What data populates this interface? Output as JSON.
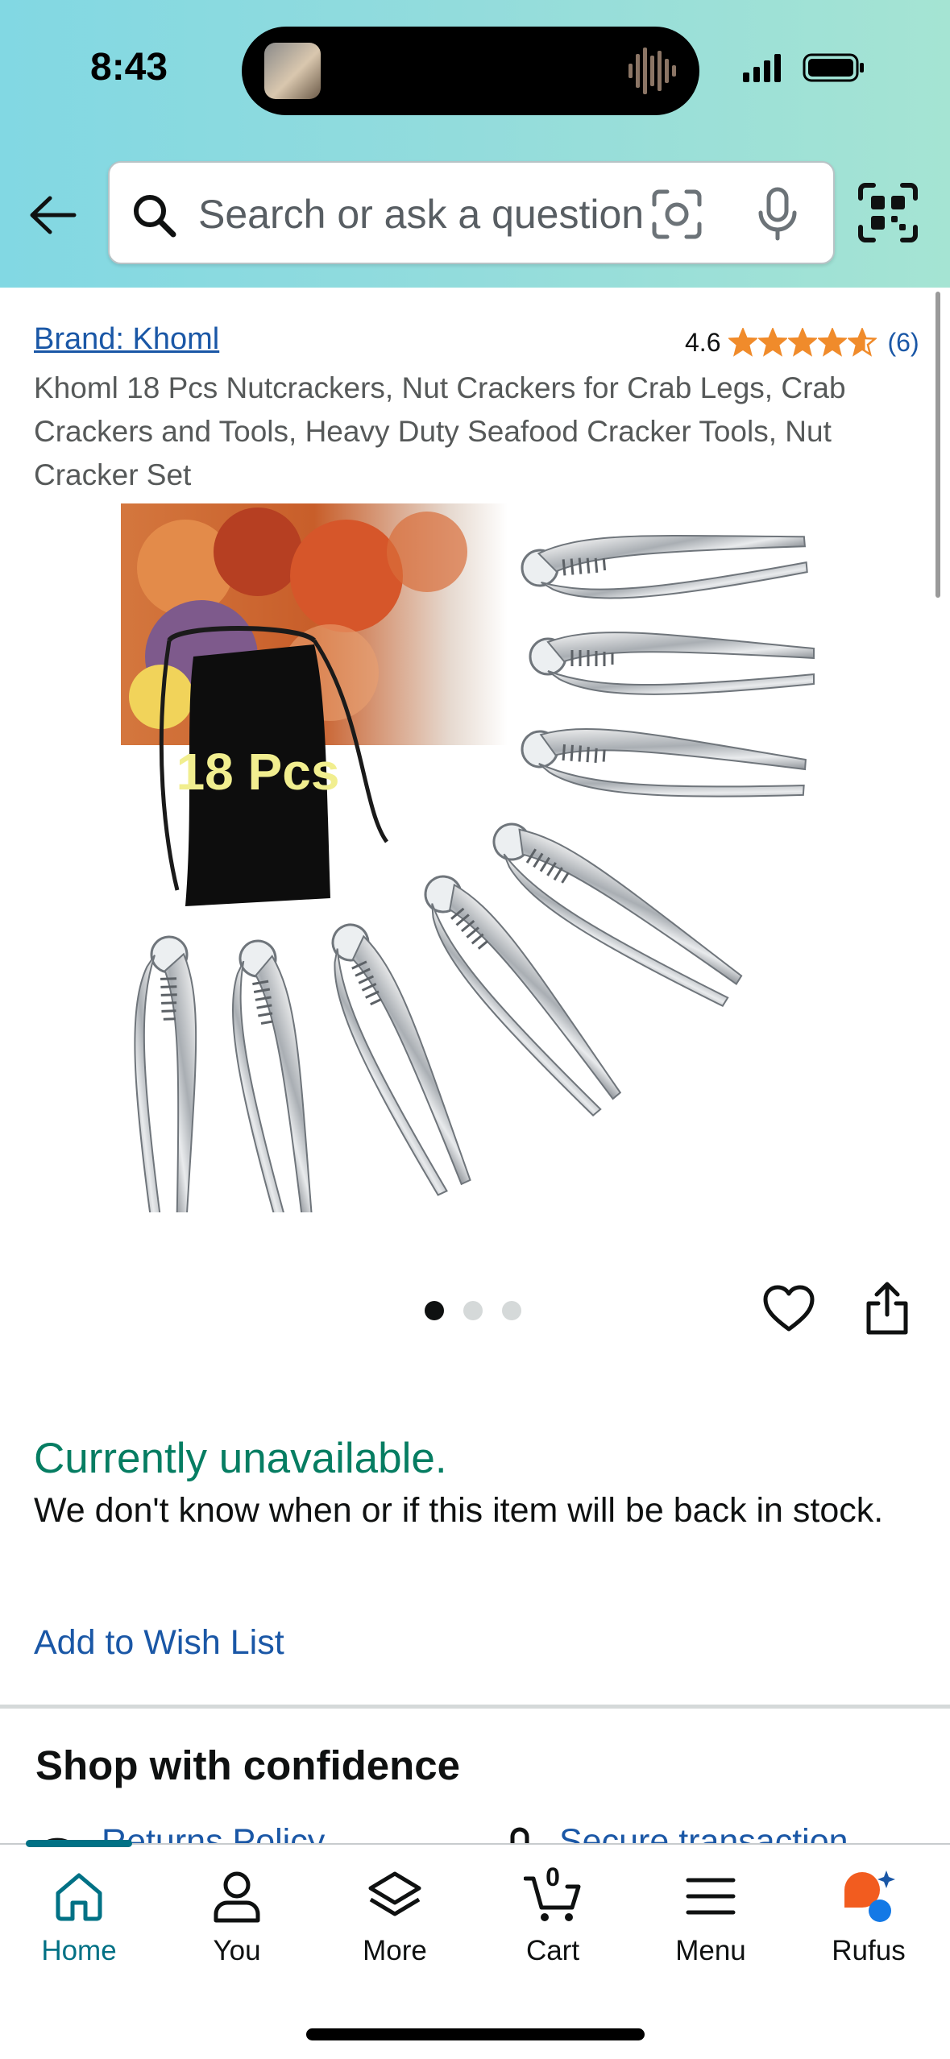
{
  "status_bar": {
    "time": "8:43"
  },
  "search": {
    "placeholder": "Search or ask a question"
  },
  "product": {
    "brand_label": "Brand: Khoml",
    "rating": "4.6",
    "rating_stars": 4.6,
    "review_count": "(6)",
    "title": "Khoml 18 Pcs Nutcrackers, Nut Crackers for Crab Legs, Crab Crackers and Tools, Heavy Duty Seafood Cracker Tools, Nut Cracker Set",
    "image_badge": "18 Pcs",
    "image_count": 3,
    "active_image": 1
  },
  "availability": {
    "status": "Currently unavailable.",
    "note": "We don't know when or if this item will be back in stock.",
    "wishlist_label": "Add to Wish List"
  },
  "confidence": {
    "title": "Shop with confidence",
    "returns_label": "Returns Policy",
    "secure_label": "Secure transaction"
  },
  "nav": {
    "home": "Home",
    "you": "You",
    "more": "More",
    "cart": "Cart",
    "cart_count": "0",
    "menu": "Menu",
    "rufus": "Rufus"
  },
  "colors": {
    "link": "#1a57a6",
    "available_green": "#067d62",
    "star": "#f08b2b",
    "nav_active": "#007185"
  }
}
